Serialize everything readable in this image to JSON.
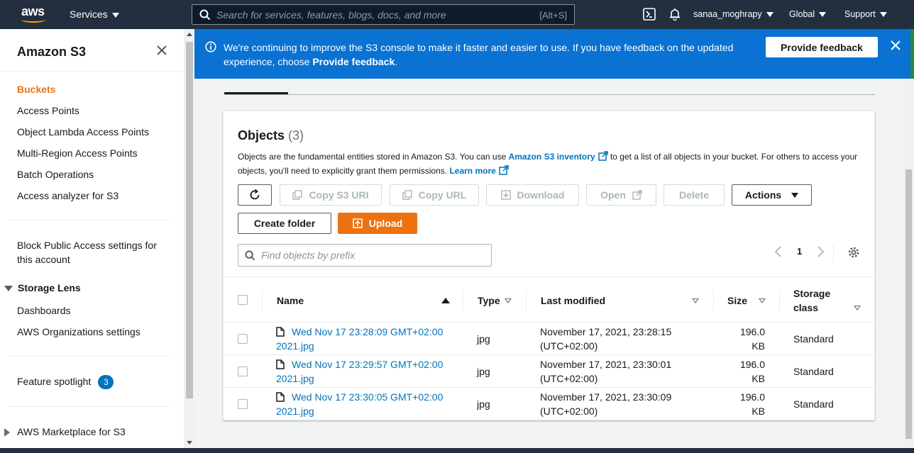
{
  "nav": {
    "logo": "aws",
    "services": "Services",
    "search_placeholder": "Search for services, features, blogs, docs, and more",
    "search_hint": "[Alt+S]",
    "user": "sanaa_moghrapy",
    "region": "Global",
    "support": "Support"
  },
  "sidebar": {
    "title": "Amazon S3",
    "items": [
      "Buckets",
      "Access Points",
      "Object Lambda Access Points",
      "Multi-Region Access Points",
      "Batch Operations",
      "Access analyzer for S3"
    ],
    "block_public": "Block Public Access settings for this account",
    "storage_lens": "Storage Lens",
    "lens_items": [
      "Dashboards",
      "AWS Organizations settings"
    ],
    "feature_spotlight": "Feature spotlight",
    "feature_count": "3",
    "marketplace": "AWS Marketplace for S3"
  },
  "banner": {
    "message_start": "We're continuing to improve the S3 console to make it faster and easier to use. If you have feedback on the updated experience, choose ",
    "message_bold": "Provide feedback",
    "message_end": ".",
    "button": "Provide feedback"
  },
  "objects": {
    "title": "Objects",
    "count": "(3)",
    "desc_1": "Objects are the fundamental entities stored in Amazon S3. You can use ",
    "desc_link_1": "Amazon S3 inventory",
    "desc_2": " to get a list of all objects in your bucket. For others to access your objects, you'll need to explicitly grant them permissions. ",
    "desc_link_2": "Learn more",
    "buttons": {
      "copy_uri": "Copy S3 URI",
      "copy_url": "Copy URL",
      "download": "Download",
      "open": "Open",
      "delete": "Delete",
      "actions": "Actions",
      "create_folder": "Create folder",
      "upload": "Upload"
    },
    "filter_placeholder": "Find objects by prefix",
    "page": "1",
    "columns": {
      "name": "Name",
      "type": "Type",
      "modified": "Last modified",
      "size": "Size",
      "class": "Storage class"
    },
    "rows": [
      {
        "name": "Wed Nov 17 23:28:09 GMT+02:00 2021.jpg",
        "type": "jpg",
        "modified": "November 17, 2021, 23:28:15 (UTC+02:00)",
        "size": "196.0 KB",
        "class": "Standard"
      },
      {
        "name": "Wed Nov 17 23:29:57 GMT+02:00 2021.jpg",
        "type": "jpg",
        "modified": "November 17, 2021, 23:30:01 (UTC+02:00)",
        "size": "196.0 KB",
        "class": "Standard"
      },
      {
        "name": "Wed Nov 17 23:30:05 GMT+02:00 2021.jpg",
        "type": "jpg",
        "modified": "November 17, 2021, 23:30:09 (UTC+02:00)",
        "size": "196.0 KB",
        "class": "Standard"
      }
    ]
  },
  "colors": {
    "nav_bg": "#232f3e",
    "accent": "#ec7211",
    "banner": "#0972d3",
    "link": "#0073bb"
  }
}
